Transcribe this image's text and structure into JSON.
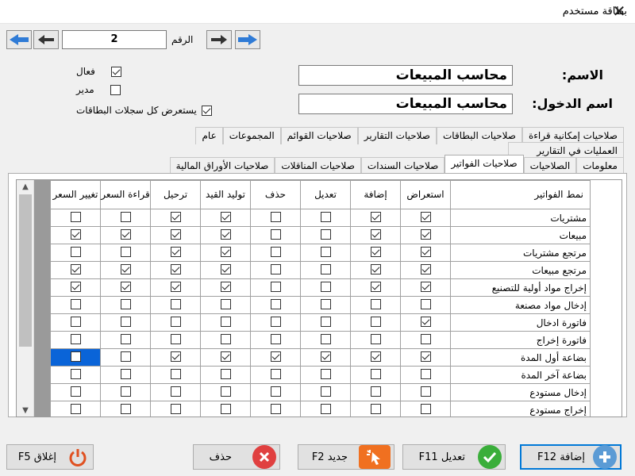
{
  "window": {
    "title": "بطاقة مستخدم",
    "close_glyph": "✕"
  },
  "nav": {
    "record_label": "الرقم",
    "record_number": "2"
  },
  "user": {
    "name_label": "الاسم:",
    "name_value": "محاسب المبيعات",
    "login_label": "اسم الدخول:",
    "login_value": "محاسب المبيعات"
  },
  "options": [
    {
      "label": "فعال",
      "checked": true
    },
    {
      "label": "مدير",
      "checked": false
    },
    {
      "label": "يستعرض كل سجلات البطاقات",
      "checked": true
    }
  ],
  "tabs_row1": [
    "صلاحيات إمكانية قراءة",
    "صلاحيات البطاقات",
    "صلاحيات التقارير",
    "صلاحيات القوائم",
    "المجموعات",
    "عام"
  ],
  "tabs_row2": [
    "العمليات في التقارير"
  ],
  "tabs_row3": [
    "معلومات",
    "الصلاحيات",
    "صلاحيات الفواتير",
    "صلاحيات السندات",
    "صلاحيات المناقلات",
    "صلاحيات الأوراق المالية"
  ],
  "active_tab": "صلاحيات الفواتير",
  "grid": {
    "columns": [
      "نمط الفواتير",
      "استعراض",
      "إضافة",
      "تعديل",
      "حذف",
      "توليد القيد",
      "ترحيل",
      "قراءة السعر",
      "تغيير السعر"
    ],
    "rows": [
      {
        "name": "مشتريات",
        "values": [
          true,
          true,
          false,
          false,
          true,
          true,
          false,
          false
        ]
      },
      {
        "name": "مبيعات",
        "values": [
          true,
          true,
          false,
          false,
          true,
          true,
          true,
          true
        ]
      },
      {
        "name": "مرتجع مشتريات",
        "values": [
          true,
          true,
          false,
          false,
          true,
          true,
          false,
          false
        ]
      },
      {
        "name": "مرتجع مبيعات",
        "values": [
          true,
          true,
          false,
          false,
          true,
          true,
          true,
          true
        ]
      },
      {
        "name": "إخراج مواد أولية للتصنيع",
        "values": [
          true,
          true,
          false,
          false,
          true,
          true,
          true,
          true
        ]
      },
      {
        "name": "إدخال مواد مصنعة",
        "values": [
          false,
          false,
          false,
          false,
          false,
          false,
          false,
          false
        ]
      },
      {
        "name": "فاتورة ادخال",
        "values": [
          true,
          false,
          false,
          false,
          false,
          false,
          false,
          false
        ]
      },
      {
        "name": "فاتورة إخراج",
        "values": [
          false,
          false,
          false,
          false,
          false,
          false,
          false,
          false
        ]
      },
      {
        "name": "بضاعة أول المدة",
        "values": [
          true,
          true,
          true,
          true,
          true,
          true,
          false,
          false
        ]
      },
      {
        "name": "بضاعة آخر المدة",
        "values": [
          false,
          false,
          false,
          false,
          false,
          false,
          false,
          false
        ]
      },
      {
        "name": "إدخال مستودع",
        "values": [
          false,
          false,
          false,
          false,
          false,
          false,
          false,
          false
        ]
      },
      {
        "name": "إخراج مستودع",
        "values": [
          false,
          false,
          false,
          false,
          false,
          false,
          false,
          false
        ]
      }
    ],
    "selected_row": 8,
    "selected_col": 7
  },
  "buttons": {
    "add": "إضافة F12",
    "edit": "تعديل F11",
    "new": "جديد F2",
    "delete": "حذف",
    "close": "إغلاق F5"
  },
  "colors": {
    "accent": "#0078d7",
    "add_icon": "#5b9bd5",
    "edit_icon": "#3aae3a",
    "new_icon": "#f07020",
    "delete_icon": "#e04040",
    "close_icon": "#e05020"
  }
}
